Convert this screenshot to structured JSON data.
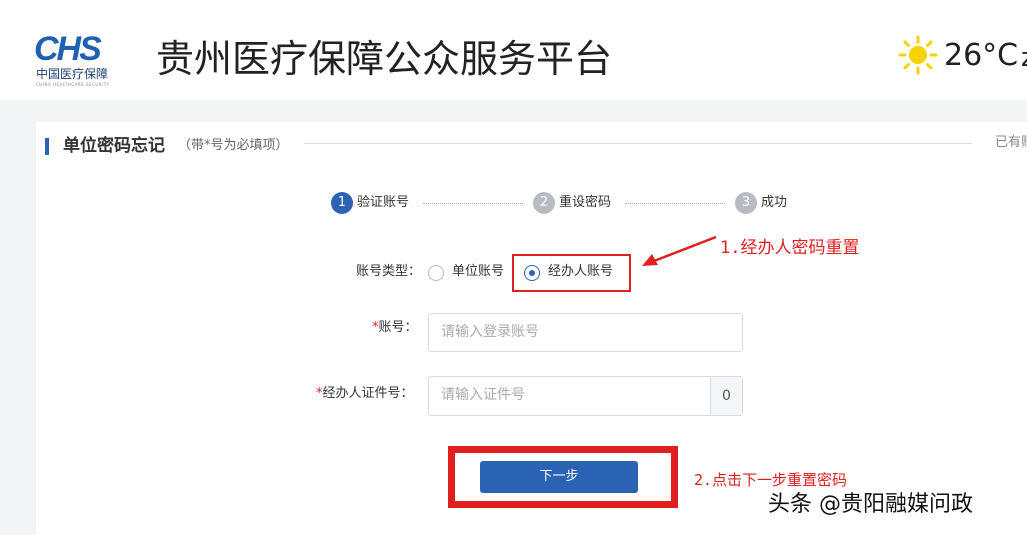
{
  "header": {
    "logo_mark": "CHS",
    "logo_cn": "中国医疗保障",
    "logo_en": "CHINA HEALTHCARE SECURITY",
    "site_title": "贵州医疗保障公众服务平台",
    "temperature": "26°C",
    "cut_text": "z"
  },
  "section": {
    "title": "单位密码忘记",
    "note": "（带*号为必填项）",
    "right_text": "已有账"
  },
  "steps": [
    {
      "num": "1",
      "label": "验证账号",
      "state": "active"
    },
    {
      "num": "2",
      "label": "重设密码",
      "state": "inactive"
    },
    {
      "num": "3",
      "label": "成功",
      "state": "inactive"
    }
  ],
  "form": {
    "account_type_label": "账号类型：",
    "radio_options": [
      {
        "label": "单位账号",
        "checked": false
      },
      {
        "label": "经办人账号",
        "checked": true
      }
    ],
    "required_mark": "*",
    "account_label": "账号：",
    "account_placeholder": "请输入登录账号",
    "id_label": "经办人证件号：",
    "id_placeholder": "请输入证件号",
    "id_counter": "0",
    "next_button": "下一步"
  },
  "annotations": {
    "note1": "1.经办人密码重置",
    "note2": "2.点击下一步重置密码",
    "color": "#e02020"
  },
  "watermark": "头条 @贵阳融媒问政",
  "colors": {
    "primary": "#2a63b4",
    "step_inactive": "#b8bcc2",
    "annotation_red": "#e02020"
  }
}
